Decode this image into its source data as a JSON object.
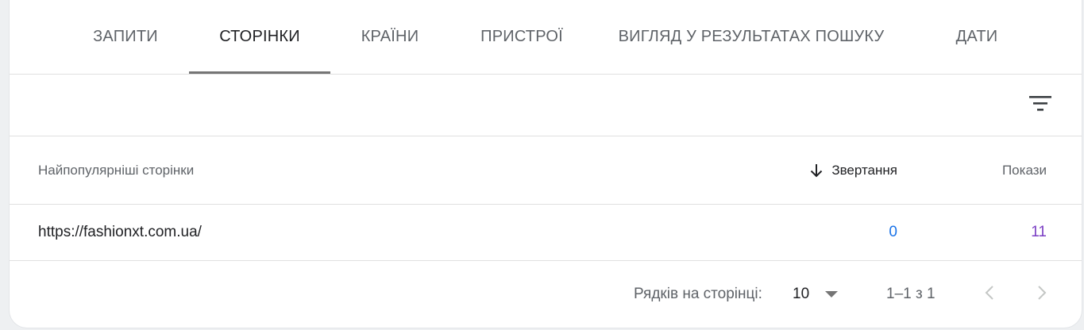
{
  "tabs": [
    {
      "label": "ЗАПИТИ"
    },
    {
      "label": "СТОРІНКИ"
    },
    {
      "label": "КРАЇНИ"
    },
    {
      "label": "ПРИСТРОЇ"
    },
    {
      "label": "ВИГЛЯД У РЕЗУЛЬТАТАХ ПОШУКУ"
    },
    {
      "label": "ДАТИ"
    }
  ],
  "active_tab": "СТОРІНКИ",
  "toolbar": {
    "filter_icon": "filter-list-icon"
  },
  "table": {
    "headers": {
      "page": "Найпопулярніші сторінки",
      "clicks": "Звертання",
      "impressions": "Покази"
    },
    "sort": {
      "column": "clicks",
      "direction": "descending",
      "icon": "arrow-down-icon"
    },
    "rows": [
      {
        "page": "https://fashionxt.com.ua/",
        "clicks": "0",
        "impressions": "11"
      }
    ]
  },
  "pagination": {
    "rows_per_page_label": "Рядків на сторінці:",
    "rows_per_page_value": "10",
    "range": "1–1 з 1"
  },
  "colors": {
    "clicks": "#1a73e8",
    "impressions": "#7b3fc4",
    "tab_underline": "#757575"
  }
}
